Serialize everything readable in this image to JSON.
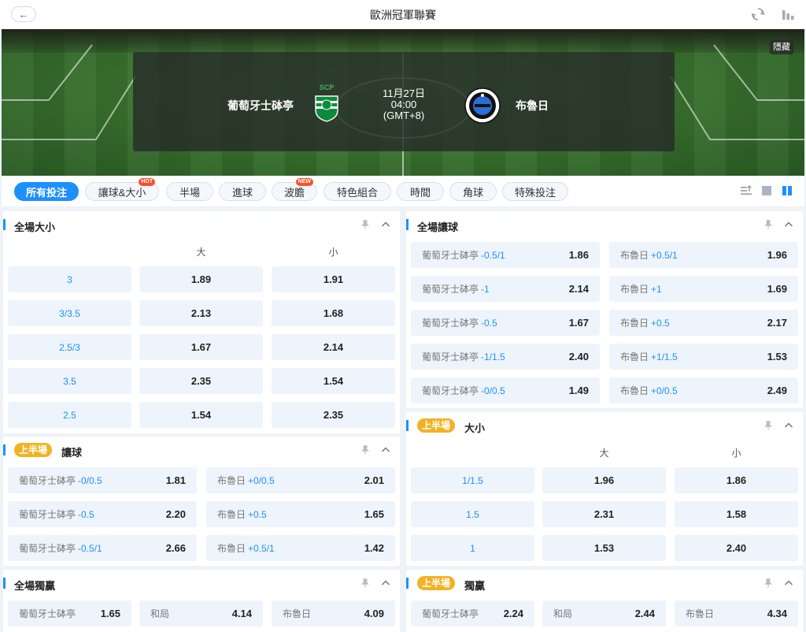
{
  "header": {
    "title": "歐洲冠軍聯賽",
    "back_icon": "arrow-left-icon"
  },
  "match": {
    "home": "葡萄牙士砵亭",
    "away": "布魯日",
    "date": "11月27日",
    "time": "04:00",
    "tz": "(GMT+8)",
    "home_logo_text": "SCP",
    "hide_label": "隱藏"
  },
  "tabs": [
    {
      "label": "所有投注",
      "badge": ""
    },
    {
      "label": "讓球&大小",
      "badge": "HOT"
    },
    {
      "label": "半場",
      "badge": ""
    },
    {
      "label": "進球",
      "badge": ""
    },
    {
      "label": "波膽",
      "badge": "NEW"
    },
    {
      "label": "特色組合",
      "badge": ""
    },
    {
      "label": "時間",
      "badge": ""
    },
    {
      "label": "角球",
      "badge": ""
    },
    {
      "label": "特殊投注",
      "badge": ""
    }
  ],
  "half_badge": "上半場",
  "colors": {
    "accent": "#1e8fff",
    "half_badge": "#f1b325",
    "hot_badge": "#f5522e"
  },
  "ft_ou": {
    "title": "全場大小",
    "col_over": "大",
    "col_under": "小",
    "rows": [
      {
        "line": "3",
        "over": "1.89",
        "under": "1.91"
      },
      {
        "line": "3/3.5",
        "over": "2.13",
        "under": "1.68"
      },
      {
        "line": "2.5/3",
        "over": "1.67",
        "under": "2.14"
      },
      {
        "line": "3.5",
        "over": "2.35",
        "under": "1.54"
      },
      {
        "line": "2.5",
        "over": "1.54",
        "under": "2.35"
      }
    ]
  },
  "ft_hdp": {
    "title": "全場讓球",
    "rows": [
      {
        "home": "葡萄牙士砵亭",
        "home_hcp": "-0.5/1",
        "home_odd": "1.86",
        "away": "布魯日",
        "away_hcp": "+0.5/1",
        "away_odd": "1.96"
      },
      {
        "home": "葡萄牙士砵亭",
        "home_hcp": "-1",
        "home_odd": "2.14",
        "away": "布魯日",
        "away_hcp": "+1",
        "away_odd": "1.69"
      },
      {
        "home": "葡萄牙士砵亭",
        "home_hcp": "-0.5",
        "home_odd": "1.67",
        "away": "布魯日",
        "away_hcp": "+0.5",
        "away_odd": "2.17"
      },
      {
        "home": "葡萄牙士砵亭",
        "home_hcp": "-1/1.5",
        "home_odd": "2.40",
        "away": "布魯日",
        "away_hcp": "+1/1.5",
        "away_odd": "1.53"
      },
      {
        "home": "葡萄牙士砵亭",
        "home_hcp": "-0/0.5",
        "home_odd": "1.49",
        "away": "布魯日",
        "away_hcp": "+0/0.5",
        "away_odd": "2.49"
      }
    ]
  },
  "ht_hdp": {
    "title": "讓球",
    "rows": [
      {
        "home": "葡萄牙士砵亭",
        "home_hcp": "-0/0.5",
        "home_odd": "1.81",
        "away": "布魯日",
        "away_hcp": "+0/0.5",
        "away_odd": "2.01"
      },
      {
        "home": "葡萄牙士砵亭",
        "home_hcp": "-0.5",
        "home_odd": "2.20",
        "away": "布魯日",
        "away_hcp": "+0.5",
        "away_odd": "1.65"
      },
      {
        "home": "葡萄牙士砵亭",
        "home_hcp": "-0.5/1",
        "home_odd": "2.66",
        "away": "布魯日",
        "away_hcp": "+0.5/1",
        "away_odd": "1.42"
      }
    ]
  },
  "ht_ou": {
    "title": "大小",
    "col_over": "大",
    "col_under": "小",
    "rows": [
      {
        "line": "1/1.5",
        "over": "1.96",
        "under": "1.86"
      },
      {
        "line": "1.5",
        "over": "2.31",
        "under": "1.58"
      },
      {
        "line": "1",
        "over": "1.53",
        "under": "2.40"
      }
    ]
  },
  "ft_1x2": {
    "title": "全場獨贏",
    "home": "葡萄牙士砵亭",
    "home_odd": "1.65",
    "draw": "和局",
    "draw_odd": "4.14",
    "away": "布魯日",
    "away_odd": "4.09"
  },
  "ht_1x2": {
    "title": "獨贏",
    "home": "葡萄牙士砵亭",
    "home_odd": "2.24",
    "draw": "和局",
    "draw_odd": "2.44",
    "away": "布魯日",
    "away_odd": "4.34"
  }
}
